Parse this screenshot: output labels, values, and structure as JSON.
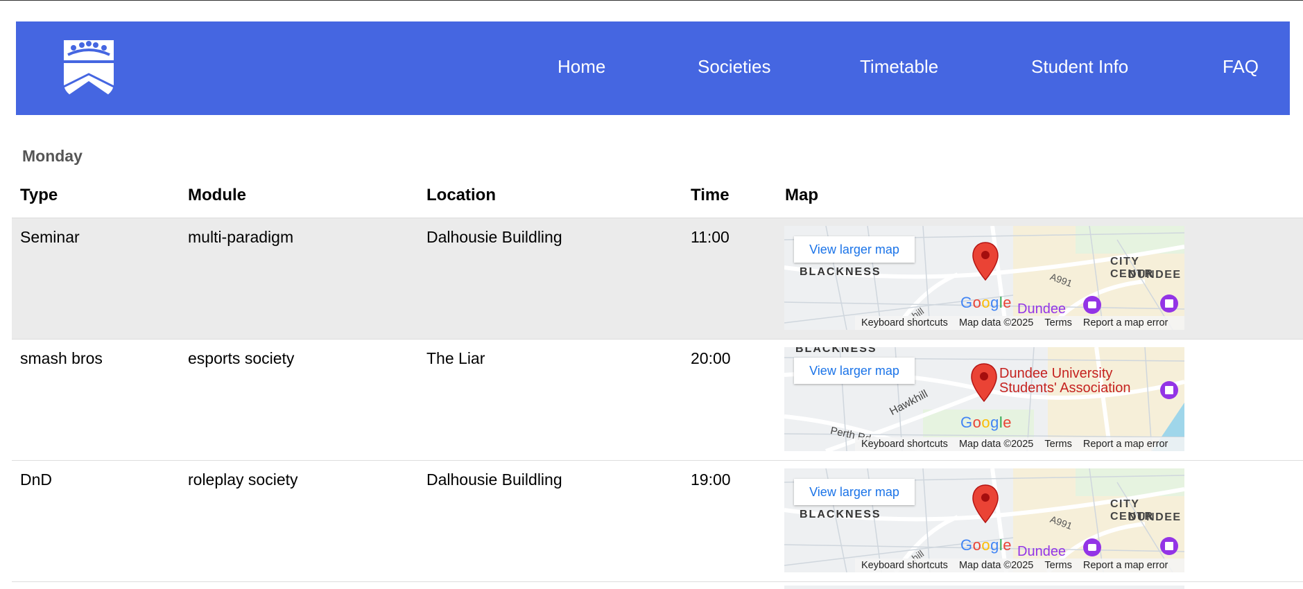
{
  "nav": {
    "links": [
      "Home",
      "Societies",
      "Timetable",
      "Student Info",
      "FAQ"
    ]
  },
  "timetable": {
    "day": "Monday",
    "headers": [
      "Type",
      "Module",
      "Location",
      "Time",
      "Map"
    ],
    "rows": [
      {
        "type": "Seminar",
        "module": "multi-paradigm",
        "location": "Dalhousie Buildling",
        "time": "11:00",
        "map": {
          "button": "View larger map",
          "labels": [
            "BLACKNESS",
            "CITY CENTR",
            "DUNDEE",
            "A991",
            "Dundee",
            "hill"
          ],
          "footer": [
            "Keyboard shortcuts",
            "Map data ©2025",
            "Terms",
            "Report a map error"
          ]
        }
      },
      {
        "type": "smash bros",
        "module": "esports society",
        "location": "The Liar",
        "time": "20:00",
        "map": {
          "button": "View larger map",
          "labels": [
            "BLACKNESS",
            "Dundee University",
            "Students' Association",
            "Hawkhill",
            "Perth Rd"
          ],
          "footer": [
            "Keyboard shortcuts",
            "Map data ©2025",
            "Terms",
            "Report a map error"
          ]
        }
      },
      {
        "type": "DnD",
        "module": "roleplay society",
        "location": "Dalhousie Buildling",
        "time": "19:00",
        "map": {
          "button": "View larger map",
          "labels": [
            "BLACKNESS",
            "CITY CENTR",
            "DUNDEE",
            "A991",
            "Dundee",
            "hill"
          ],
          "footer": [
            "Keyboard shortcuts",
            "Map data ©2025",
            "Terms",
            "Report a map error"
          ]
        }
      }
    ]
  },
  "google_logo": [
    "G",
    "o",
    "o",
    "g",
    "l",
    "e"
  ]
}
